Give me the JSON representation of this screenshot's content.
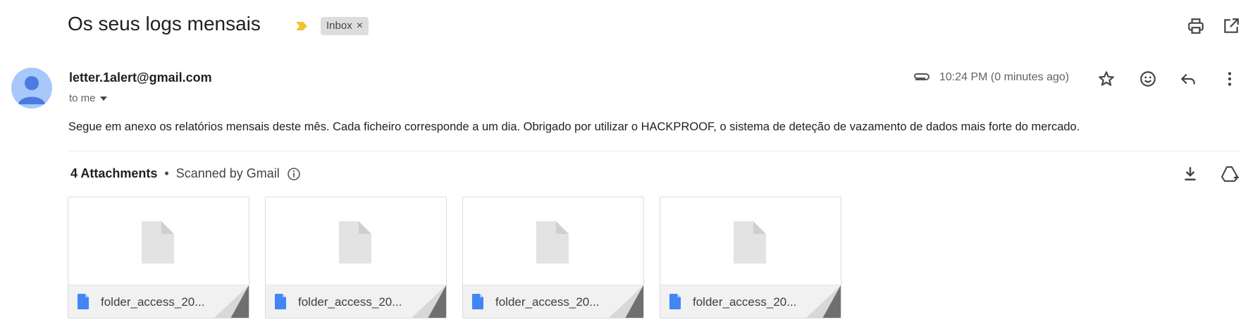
{
  "subject": "Os seus logs mensais",
  "label_chip": {
    "text": "Inbox",
    "close": "×"
  },
  "sender": {
    "email": "letter.1alert@gmail.com",
    "recipient": "to me"
  },
  "timestamp": "10:24 PM (0 minutes ago)",
  "body": "Segue em anexo os relatórios mensais deste mês. Cada ficheiro corresponde a um dia. Obrigado por utilizar o HACKPROOF, o sistema de deteção de vazamento de dados mais forte do mercado.",
  "attachments_header": {
    "count": "4 Attachments",
    "separator": "•",
    "scan": "Scanned by Gmail"
  },
  "attachments": [
    {
      "name": "folder_access_20..."
    },
    {
      "name": "folder_access_20..."
    },
    {
      "name": "folder_access_20..."
    },
    {
      "name": "folder_access_20..."
    }
  ],
  "icons": {
    "important": "importance-marker-icon",
    "print": "print-icon",
    "new_window": "open-in-new-window-icon",
    "attachment": "paperclip-icon",
    "star": "star-icon",
    "emoji": "emoji-reaction-icon",
    "reply": "reply-icon",
    "more": "more-vert-icon",
    "download_all": "download-icon",
    "save_to_drive": "add-to-drive-icon",
    "info": "info-icon",
    "file": "google-docs-file-icon"
  },
  "colors": {
    "important": "#f2c230",
    "avatar_bg": "#a8c7fa",
    "avatar_fg": "#4a7be0",
    "doc_blue": "#4285f4"
  }
}
